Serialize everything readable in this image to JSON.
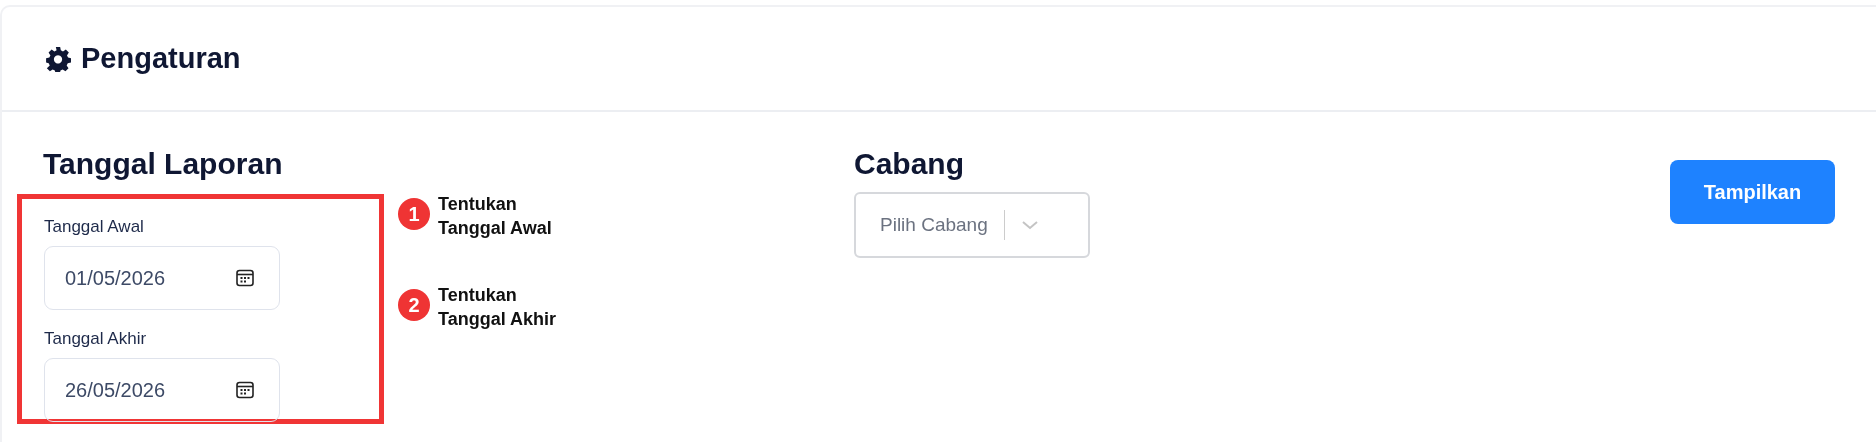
{
  "header": {
    "title": "Pengaturan"
  },
  "report_date": {
    "heading": "Tanggal Laporan",
    "fields": [
      {
        "label": "Tanggal Awal",
        "value": "01/05/2026"
      },
      {
        "label": "Tanggal Akhir",
        "value": "26/05/2026"
      }
    ]
  },
  "annotations": [
    {
      "number": "1",
      "text": "Tentukan Tanggal Awal"
    },
    {
      "number": "2",
      "text": "Tentukan Tanggal Akhir"
    }
  ],
  "branch": {
    "heading": "Cabang",
    "select": {
      "placeholder": "Pilih Cabang"
    }
  },
  "submit_button": {
    "label": "Tampilkan"
  }
}
